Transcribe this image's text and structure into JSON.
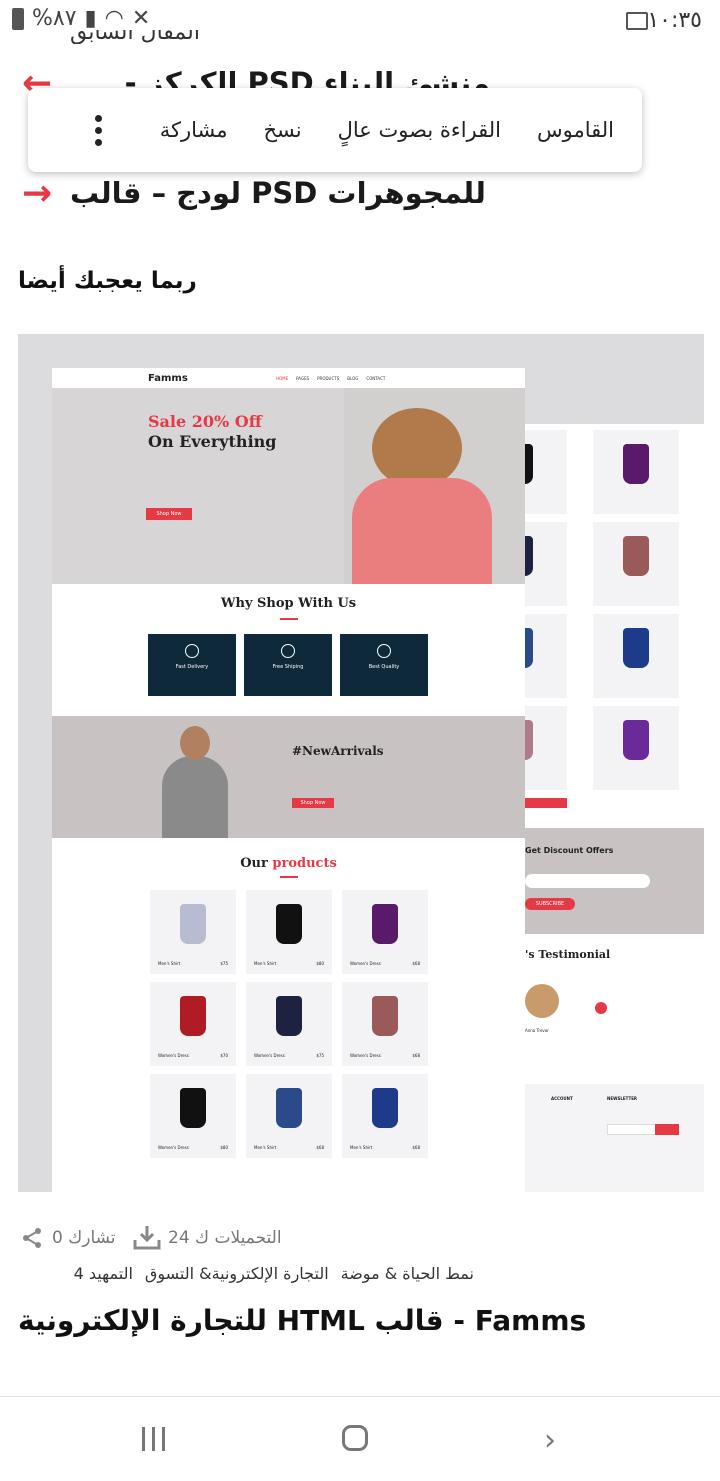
{
  "status_bar": {
    "time": "١٠:٣٥",
    "battery": "%٨٧"
  },
  "background_links": {
    "partial_top": "المقال السابق",
    "link1": "منشئ البناء PSD الكركز - قالب",
    "link2": "للمجوهرات PSD لودج – قالب"
  },
  "popup": {
    "items": [
      "القاموس",
      "القراءة بصوت عالٍ",
      "نسخ",
      "مشاركة"
    ]
  },
  "related_heading": "ربما يعجبك أيضا",
  "thumbnail": {
    "logo": "Famms",
    "nav": [
      "HOME",
      "PAGES",
      "PRODUCTS",
      "BLOG",
      "CONTACT"
    ],
    "hero_line1": "Sale 20% Off",
    "hero_line2": "On Everything",
    "hero_button": "Shop Now",
    "why_title": "Why Shop With Us",
    "features": [
      "Fast Delivery",
      "Free Shiping",
      "Best Quality"
    ],
    "arrivals_title": "#NewArrivals",
    "arrivals_button": "Shop Now",
    "products_title_a": "Our",
    "products_title_b": "products",
    "products": [
      {
        "name": "Men's Shirt",
        "price": "$75",
        "color": "#b8bcd0"
      },
      {
        "name": "Men's Shirt",
        "price": "$80",
        "color": "#111111"
      },
      {
        "name": "Women's Dress",
        "price": "$68",
        "color": "#5a1a6a"
      },
      {
        "name": "Women's Dress",
        "price": "$70",
        "color": "#b01c24"
      },
      {
        "name": "Women's Dress",
        "price": "$75",
        "color": "#1c2240"
      },
      {
        "name": "Women's Dress",
        "price": "$68",
        "color": "#9a5a5a"
      },
      {
        "name": "Women's Dress",
        "price": "$80",
        "color": "#111111"
      },
      {
        "name": "Men's Shirt",
        "price": "$68",
        "color": "#2a4a8a"
      },
      {
        "name": "Men's Shirt",
        "price": "$68",
        "color": "#1e3a8a"
      }
    ],
    "discount_title": "Get Discount Offers",
    "subscribe": "SUBSCRIBE",
    "testimonial": "'s Testimonial",
    "testimonial_name": "Anna Trevor",
    "footer_account": "ACCOUNT",
    "footer_newsletter": "NEWSLETTER"
  },
  "meta": {
    "downloads": "التحميلات ك 24",
    "shares": "تشارك 0"
  },
  "tags": [
    "التمهيد 4",
    "التجارة الإلكترونية& التسوق",
    "نمط الحياة & موضة"
  ],
  "post_title": "Famms - قالب HTML للتجارة الإلكترونية"
}
